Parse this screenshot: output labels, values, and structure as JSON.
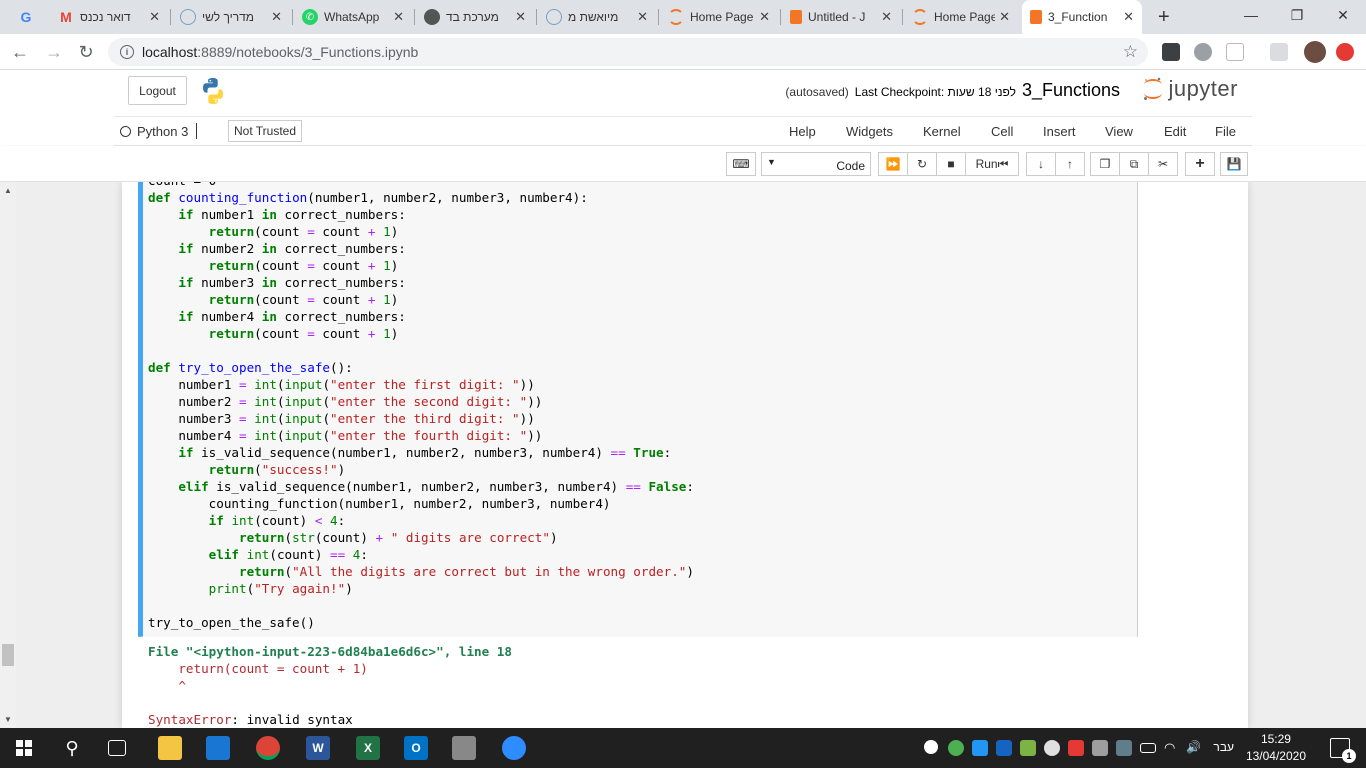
{
  "browser": {
    "tabs": [
      {
        "title": "",
        "icon": "google-icon",
        "color": "#4285f4",
        "letter": "G"
      },
      {
        "title": "דואר נכנס",
        "icon": "gmail-icon",
        "color": "#ea4335",
        "letter": "M"
      },
      {
        "title": "מדריך לשי",
        "icon": "globe-icon",
        "color": "#7aa0c4",
        "letter": "◉"
      },
      {
        "title": "WhatsApp",
        "icon": "whatsapp-icon",
        "color": "#25d366",
        "letter": "✆"
      },
      {
        "title": "מערכת בד",
        "icon": "circle-icon",
        "color": "#555555",
        "letter": "●"
      },
      {
        "title": "מיואשת מ",
        "icon": "globe-icon",
        "color": "#7aa0c4",
        "letter": "◉"
      },
      {
        "title": "Home Page",
        "icon": "jupyter-icon",
        "color": "#f37626",
        "letter": "◌"
      },
      {
        "title": "Untitled - J",
        "icon": "notebook-icon",
        "color": "#f37626",
        "letter": "▤"
      },
      {
        "title": "Home Page",
        "icon": "jupyter-icon",
        "color": "#f37626",
        "letter": "◌"
      },
      {
        "title": "3_Function",
        "icon": "notebook-icon",
        "color": "#f37626",
        "letter": "▤"
      }
    ],
    "new_tab": "+",
    "url_host": "localhost",
    "url_path": ":8889/notebooks/3_Functions.ipynb"
  },
  "jupyter": {
    "logout": "Logout",
    "notebook_name": "3_Functions",
    "checkpoint": "Last Checkpoint: לפני 18 שעות",
    "autosaved": "(autosaved)",
    "logo_text": "jupyter",
    "kernel": "Python 3",
    "trusted": "Not Trusted",
    "menu": [
      "File",
      "Edit",
      "View",
      "Insert",
      "Cell",
      "Kernel",
      "Widgets",
      "Help"
    ],
    "run_label": "Run",
    "cell_type": "Code"
  },
  "error": {
    "file_line": "File \"<ipython-input-223-6d84ba1e6d6c>\", line 18",
    "code_line": "    return(count = count + 1)",
    "caret": "    ^",
    "error_type": "SyntaxError",
    "error_msg": "invalid syntax"
  },
  "taskbar": {
    "lang": "עבר",
    "time": "15:29",
    "date": "13/04/2020",
    "notifications": "1"
  }
}
